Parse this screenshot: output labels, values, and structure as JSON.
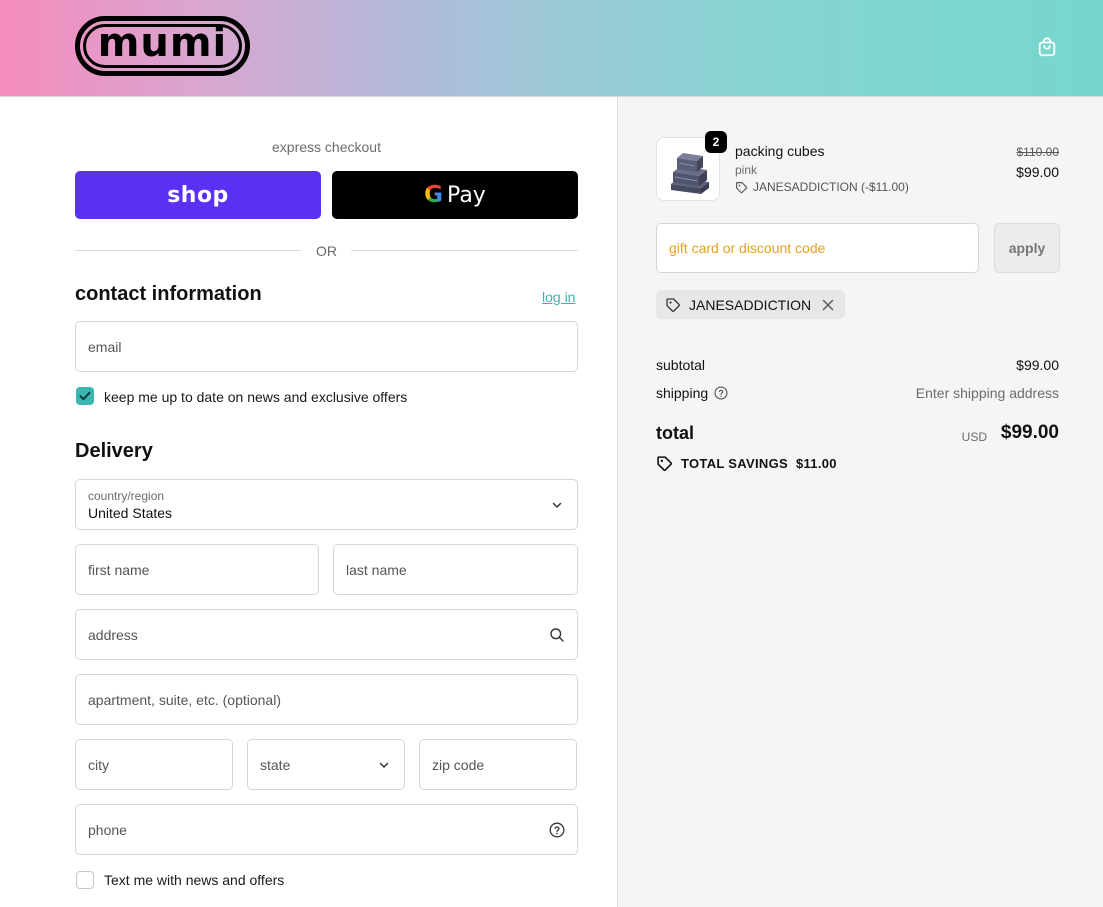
{
  "header": {
    "logo_text": "mumi",
    "cart_icon": "shopping-bag-icon"
  },
  "checkout": {
    "express_label": "express checkout",
    "shop_pay_label": "shop",
    "gpay_g": "G",
    "gpay_label": "Pay",
    "or_label": "OR"
  },
  "contact": {
    "title": "contact information",
    "login_label": "log in",
    "email_placeholder": "email",
    "newsletter_label": "keep me up to date on news and exclusive offers",
    "newsletter_checked": true
  },
  "delivery": {
    "title": "Delivery",
    "country_label": "country/region",
    "country_value": "United States",
    "first_name_placeholder": "first name",
    "last_name_placeholder": "last name",
    "address_placeholder": "address",
    "apartment_placeholder": "apartment, suite, etc. (optional)",
    "city_placeholder": "city",
    "state_placeholder": "state",
    "zip_placeholder": "zip code",
    "phone_placeholder": "phone",
    "sms_label": "Text me with news and offers",
    "sms_checked": false
  },
  "order": {
    "item": {
      "name": "packing cubes",
      "variant": "pink",
      "quantity": "2",
      "discount_line": "JANESADDICTION (-$11.00)",
      "original_price": "$110.00",
      "price": "$99.00"
    },
    "discount_placeholder": "gift card or discount code",
    "apply_label": "apply",
    "applied_code": "JANESADDICTION",
    "subtotal_label": "subtotal",
    "subtotal_value": "$99.00",
    "shipping_label": "shipping",
    "shipping_value": "Enter shipping address",
    "total_label": "total",
    "total_currency": "USD",
    "total_value": "$99.00",
    "savings_label": "TOTAL SAVINGS",
    "savings_value": "$11.00"
  },
  "colors": {
    "accent": "#3bb5b0",
    "shop_pay": "#5a31f4",
    "discount_placeholder": "#e6a11d"
  }
}
